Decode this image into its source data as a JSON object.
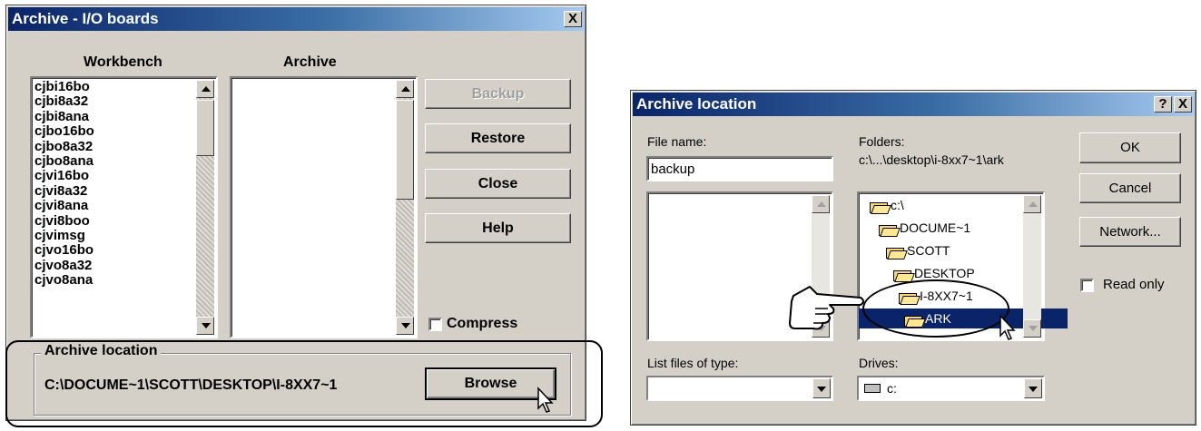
{
  "left_dialog": {
    "title": "Archive - I/O boards",
    "workbench_label": "Workbench",
    "archive_label": "Archive",
    "workbench_items": [
      "cjbi16bo",
      "cjbi8a32",
      "cjbi8ana",
      "cjbo16bo",
      "cjbo8a32",
      "cjbo8ana",
      "cjvi16bo",
      "cjvi8a32",
      "cjvi8ana",
      "cjvi8boo",
      "cjvimsg",
      "cjvo16bo",
      "cjvo8a32",
      "cjvo8ana"
    ],
    "buttons": {
      "backup": "Backup",
      "restore": "Restore",
      "close": "Close",
      "help": "Help",
      "browse": "Browse"
    },
    "compress_label": "Compress",
    "archive_location_label": "Archive location",
    "archive_location_path": "C:\\DOCUME~1\\SCOTT\\DESKTOP\\I-8XX7~1"
  },
  "right_dialog": {
    "title": "Archive location",
    "help_btn": "?",
    "file_name_label": "File name:",
    "file_name_value": "backup",
    "folders_label": "Folders:",
    "folders_path": "c:\\...\\desktop\\i-8xx7~1\\ark",
    "folders": [
      "c:\\",
      "DOCUME~1",
      "SCOTT",
      "DESKTOP",
      "I-8XX7~1",
      "ARK"
    ],
    "selected_folder": "ARK",
    "buttons": {
      "ok": "OK",
      "cancel": "Cancel",
      "network": "Network..."
    },
    "read_only_label": "Read only",
    "list_files_label": "List files of type:",
    "drives_label": "Drives:",
    "drive_value": "c:"
  },
  "close_glyph": "X"
}
